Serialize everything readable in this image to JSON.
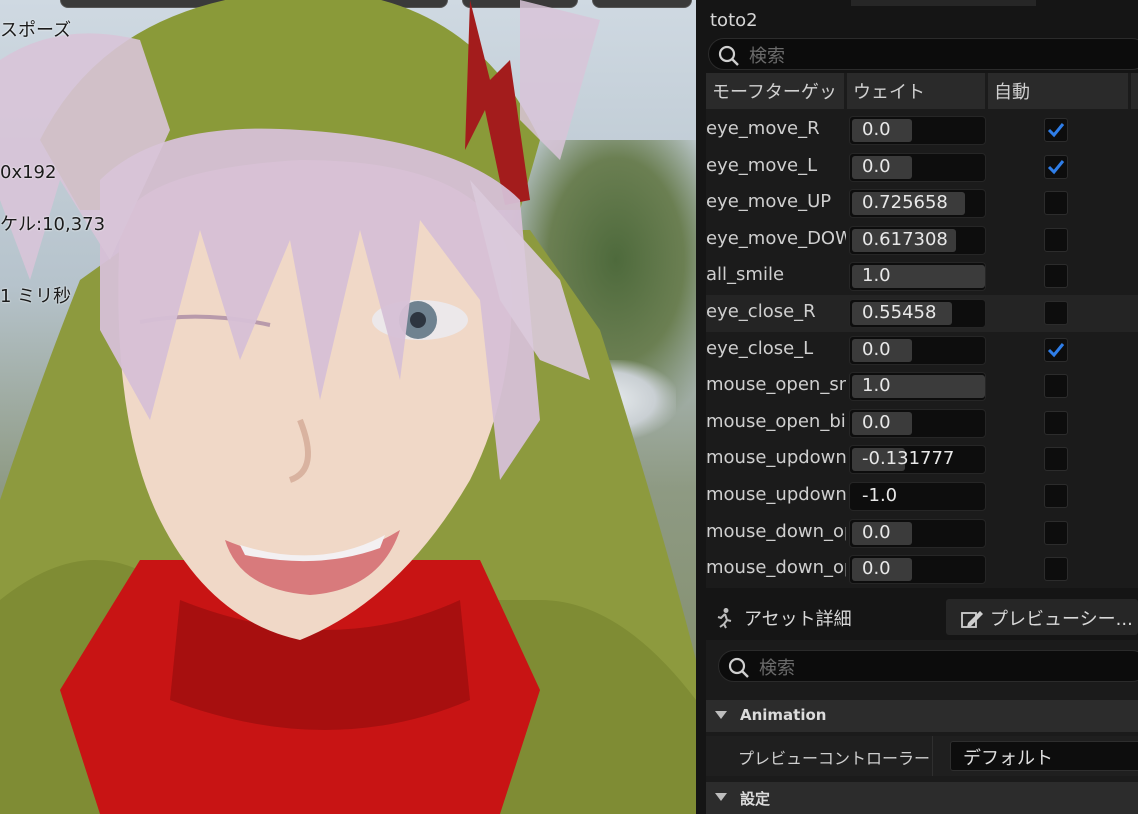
{
  "viewport": {
    "overlay_lines": [
      "スポーズ",
      "0x192",
      "ケル:10,373",
      "1 ミリ秒"
    ]
  },
  "panel": {
    "title": "toto2",
    "search_placeholder": "検索",
    "columns": [
      "モーフターゲッ",
      "ウェイト",
      "自動"
    ],
    "rows": [
      {
        "name": "eye_move_R",
        "value": "0.0",
        "fill": 0.45,
        "auto": true
      },
      {
        "name": "eye_move_L",
        "value": "0.0",
        "fill": 0.45,
        "auto": true
      },
      {
        "name": "eye_move_UP",
        "value": "0.725658",
        "fill": 0.85,
        "auto": false
      },
      {
        "name": "eye_move_DOW",
        "value": "0.617308",
        "fill": 0.78,
        "auto": false
      },
      {
        "name": "all_smile",
        "value": "1.0",
        "fill": 1.0,
        "auto": false
      },
      {
        "name": "eye_close_R",
        "value": "0.55458",
        "fill": 0.75,
        "auto": false
      },
      {
        "name": "eye_close_L",
        "value": "0.0",
        "fill": 0.45,
        "auto": true
      },
      {
        "name": "mouse_open_sn",
        "value": "1.0",
        "fill": 1.0,
        "auto": false
      },
      {
        "name": "mouse_open_bi",
        "value": "0.0",
        "fill": 0.45,
        "auto": false
      },
      {
        "name": "mouse_updown",
        "value": "-0.131777",
        "fill": 0.4,
        "auto": false
      },
      {
        "name": "mouse_updown",
        "value": "-1.0",
        "fill": 0.0,
        "auto": false
      },
      {
        "name": "mouse_down_op",
        "value": "0.0",
        "fill": 0.45,
        "auto": false
      },
      {
        "name": "mouse_down_op",
        "value": "0.0",
        "fill": 0.45,
        "auto": false
      }
    ],
    "tabs": [
      {
        "label": "アセット詳細",
        "icon": "running-person-icon"
      },
      {
        "label": "プレビューシー...",
        "icon": "edit-scene-icon"
      }
    ],
    "details_search_placeholder": "検索",
    "sections": [
      "Animation",
      "設定"
    ],
    "preview_controller_label": "プレビューコントローラー",
    "preview_controller_value": "デフォルト"
  },
  "colors": {
    "accent": "#2f7ee8",
    "panel_bg": "#151515",
    "header_bg": "#2a2a2a"
  }
}
